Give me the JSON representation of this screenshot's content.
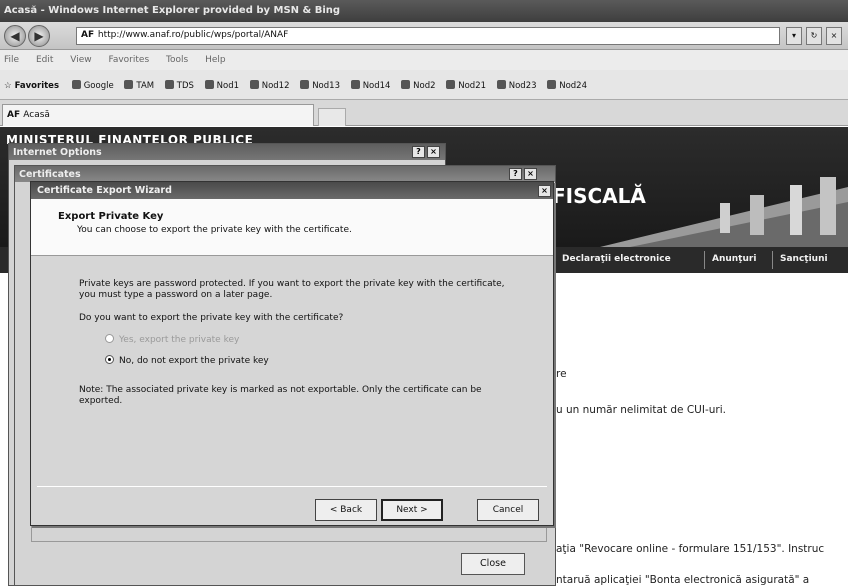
{
  "window": {
    "title": "Acasă - Windows Internet Explorer provided by MSN & Bing"
  },
  "navbar": {
    "back_label": "◀",
    "forward_label": "▶",
    "url": "http://www.anaf.ro/public/wps/portal/ANAF",
    "url_host": "anaf",
    "go_label": "▾",
    "refresh_label": "↻",
    "stop_label": "×"
  },
  "menubar": {
    "items": [
      "File",
      "Edit",
      "View",
      "Favorites",
      "Tools",
      "Help"
    ]
  },
  "favorites": {
    "label": "Favorites",
    "items": [
      "Google",
      "TAM",
      "TDS",
      "Nod1",
      "Nod12",
      "Nod13",
      "Nod14",
      "Nod2",
      "Nod21",
      "Nod23",
      "Nod24"
    ]
  },
  "tab": {
    "label": "Acasă"
  },
  "page": {
    "ministry": "MINISTERUL FINANTELOR PUBLICE",
    "agency": "FISCALĂ",
    "nav": [
      "Declaraţii electronice",
      "Anunţuri",
      "Sancţiuni"
    ],
    "line1": "re",
    "line2": "u un număr nelimitat de CUI-uri.",
    "line3": "aţia \"Revocare online - formulare 151/153\". Instruc",
    "line4": "ntaruă aplicaţiei \"Bonta electronică asigurată\" a"
  },
  "internet_options": {
    "title": "Internet Options",
    "help_label": "?",
    "close_label": "×",
    "close_button": "Close"
  },
  "certificates": {
    "title": "Certificates",
    "help_label": "?",
    "close_label": "×"
  },
  "wizard": {
    "title": "Certificate Export Wizard",
    "close_label": "×",
    "header_title": "Export Private Key",
    "header_subtitle": "You can choose to export the private key with the certificate.",
    "para1": "Private keys are password protected. If you want to export the private key with the certificate, you must type a password on a later page.",
    "question": "Do you want to export the private key with the certificate?",
    "option_yes": "Yes, export the private key",
    "option_no": "No, do not export the private key",
    "note": "Note: The associated private key is marked as not exportable. Only the certificate can be exported.",
    "back_button": "< Back",
    "next_button": "Next >",
    "cancel_button": "Cancel"
  }
}
